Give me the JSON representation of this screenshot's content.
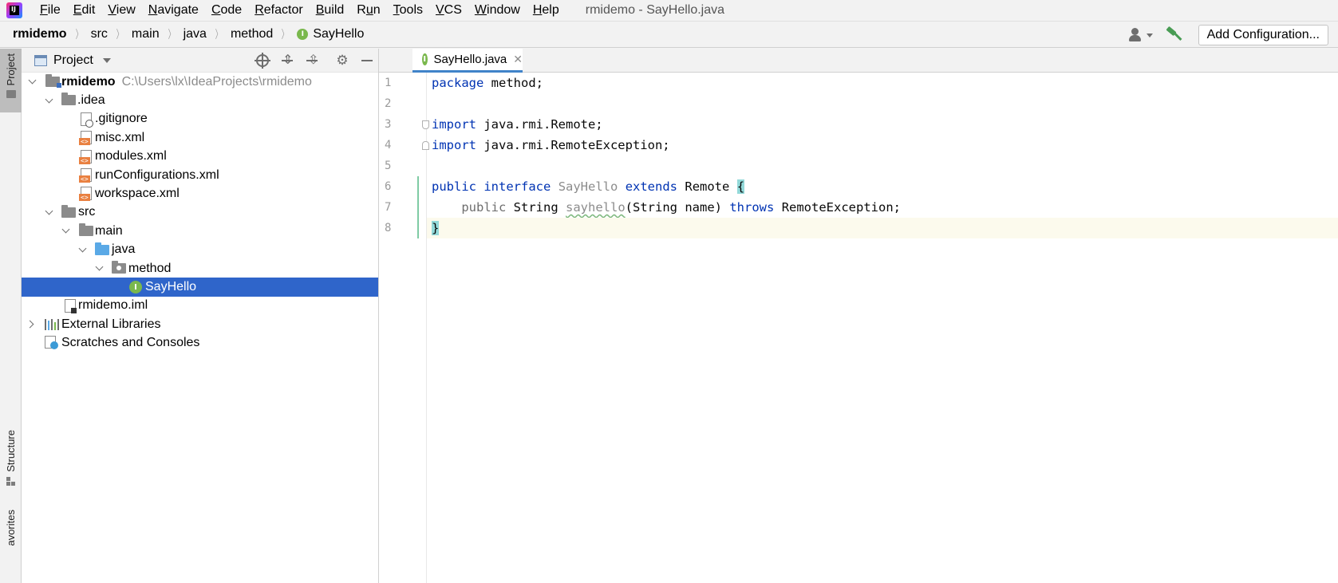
{
  "menu": {
    "items": [
      {
        "label": "File",
        "mnemonic": "F",
        "rest": "ile"
      },
      {
        "label": "Edit",
        "mnemonic": "E",
        "rest": "dit"
      },
      {
        "label": "View",
        "mnemonic": "V",
        "rest": "iew"
      },
      {
        "label": "Navigate",
        "mnemonic": "N",
        "rest": "avigate"
      },
      {
        "label": "Code",
        "mnemonic": "C",
        "rest": "ode"
      },
      {
        "label": "Refactor",
        "mnemonic": "R",
        "rest": "efactor"
      },
      {
        "label": "Build",
        "mnemonic": "B",
        "rest": "uild"
      },
      {
        "label": "Run",
        "mnemonic": "",
        "prefix": "R",
        "u": "u",
        "rest": "n"
      },
      {
        "label": "Tools",
        "mnemonic": "T",
        "rest": "ools"
      },
      {
        "label": "VCS",
        "mnemonic": "",
        "prefix": "",
        "u": "V",
        "rest": "CS"
      },
      {
        "label": "Window",
        "mnemonic": "W",
        "rest": "indow"
      },
      {
        "label": "Help",
        "mnemonic": "H",
        "rest": "elp"
      }
    ],
    "window_title": "rmidemo - SayHello.java"
  },
  "breadcrumb": {
    "items": [
      "rmidemo",
      "src",
      "main",
      "java",
      "method",
      "SayHello"
    ]
  },
  "toolbar": {
    "add_configuration_label": "Add Configuration..."
  },
  "left_strip": {
    "project_tab": "Project",
    "structure_tab": "Structure",
    "favorites_tab": "avorites"
  },
  "project_panel": {
    "title": "Project",
    "tree": [
      {
        "label": "rmidemo",
        "path": "C:\\Users\\lx\\IdeaProjects\\rmidemo"
      },
      {
        "label": ".idea"
      },
      {
        "label": ".gitignore"
      },
      {
        "label": "misc.xml"
      },
      {
        "label": "modules.xml"
      },
      {
        "label": "runConfigurations.xml"
      },
      {
        "label": "workspace.xml"
      },
      {
        "label": "src"
      },
      {
        "label": "main"
      },
      {
        "label": "java"
      },
      {
        "label": "method"
      },
      {
        "label": "SayHello"
      },
      {
        "label": "rmidemo.iml"
      },
      {
        "label": "External Libraries"
      },
      {
        "label": "Scratches and Consoles"
      }
    ]
  },
  "editor": {
    "tab_label": "SayHello.java",
    "line_numbers": [
      "1",
      "2",
      "3",
      "4",
      "5",
      "6",
      "7",
      "8"
    ],
    "code": {
      "l1_kw": "package",
      "l1_rest": " method;",
      "l3_kw": "import",
      "l3_rest": " java.rmi.Remote;",
      "l4_kw": "import",
      "l4_rest": " java.rmi.RemoteException;",
      "l6_kw1": "public",
      "l6_kw2": "interface",
      "l6_name": "SayHello",
      "l6_kw3": "extends",
      "l6_rest": "Remote",
      "l6_brace": "{",
      "l7_kw1": "public",
      "l7_type": "String",
      "l7_method": "sayhello",
      "l7_params": "(String name)",
      "l7_kw2": "throws",
      "l7_rest": "RemoteException;",
      "l8_brace": "}"
    }
  },
  "colors": {
    "keyword": "#0033b3",
    "selection": "#2f65ca",
    "interface_badge": "#7ab84d",
    "xml_badge": "#e98040"
  }
}
